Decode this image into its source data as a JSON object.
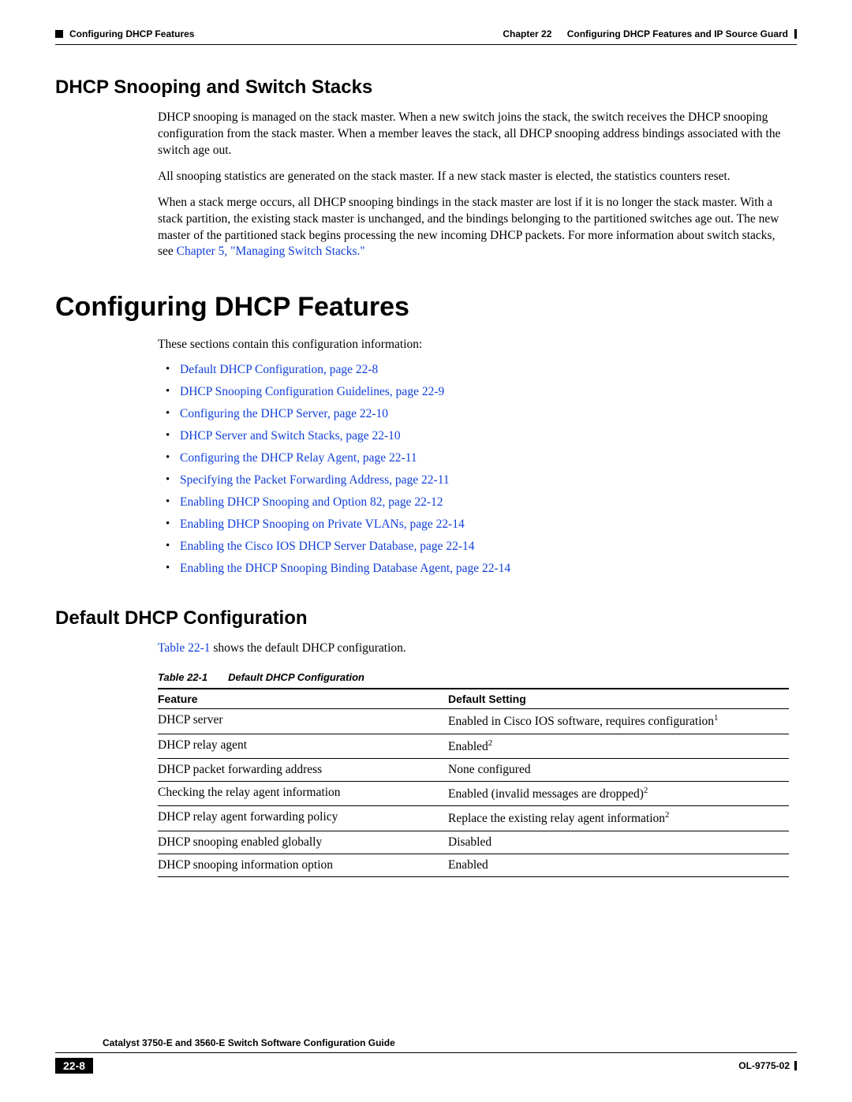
{
  "header": {
    "section_marker": "Configuring DHCP Features",
    "chapter_label": "Chapter 22",
    "chapter_title": "Configuring DHCP Features and IP Source Guard"
  },
  "h2_snooping": "DHCP Snooping and Switch Stacks",
  "snooping_p1": "DHCP snooping is managed on the stack master. When a new switch joins the stack, the switch receives the DHCP snooping configuration from the stack master. When a member leaves the stack, all DHCP snooping address bindings associated with the switch age out.",
  "snooping_p2": "All snooping statistics are generated on the stack master. If a new stack master is elected, the statistics counters reset.",
  "snooping_p3_a": "When a stack merge occurs, all DHCP snooping bindings in the stack master are lost if it is no longer the stack master. With a stack partition, the existing stack master is unchanged, and the bindings belonging to the partitioned switches age out. The new master of the partitioned stack begins processing the new incoming DHCP packets. For more information about switch stacks, see ",
  "snooping_p3_link": "Chapter 5, \"Managing Switch Stacks.\"",
  "h1_configuring": "Configuring DHCP Features",
  "intro": "These sections contain this configuration information:",
  "toc": [
    "Default DHCP Configuration, page 22-8",
    "DHCP Snooping Configuration Guidelines, page 22-9",
    "Configuring the DHCP Server, page 22-10",
    "DHCP Server and Switch Stacks, page 22-10",
    "Configuring the DHCP Relay Agent, page 22-11",
    "Specifying the Packet Forwarding Address, page 22-11",
    "Enabling DHCP Snooping and Option 82, page 22-12",
    "Enabling DHCP Snooping on Private VLANs, page 22-14",
    "Enabling the Cisco IOS DHCP Server Database, page 22-14",
    "Enabling the DHCP Snooping Binding Database Agent, page 22-14"
  ],
  "h2_default": "Default DHCP Configuration",
  "default_intro_link": "Table 22-1",
  "default_intro_rest": " shows the default DHCP configuration.",
  "table_caption_num": "Table 22-1",
  "table_caption_title": "Default DHCP Configuration",
  "table": {
    "head_feature": "Feature",
    "head_default": "Default Setting",
    "rows": [
      {
        "f": "DHCP server",
        "d": "Enabled in Cisco IOS software, requires configuration",
        "sup": "1"
      },
      {
        "f": "DHCP relay agent",
        "d": "Enabled",
        "sup": "2"
      },
      {
        "f": "DHCP packet forwarding address",
        "d": "None configured",
        "sup": ""
      },
      {
        "f": "Checking the relay agent information",
        "d": "Enabled (invalid messages are dropped)",
        "sup": "2"
      },
      {
        "f": "DHCP relay agent forwarding policy",
        "d": "Replace the existing relay agent information",
        "sup": "2"
      },
      {
        "f": "DHCP snooping enabled globally",
        "d": "Disabled",
        "sup": ""
      },
      {
        "f": "DHCP snooping information option",
        "d": "Enabled",
        "sup": ""
      }
    ]
  },
  "footer": {
    "guide": "Catalyst 3750-E and 3560-E Switch Software Configuration Guide",
    "pagenum": "22-8",
    "docid": "OL-9775-02"
  }
}
